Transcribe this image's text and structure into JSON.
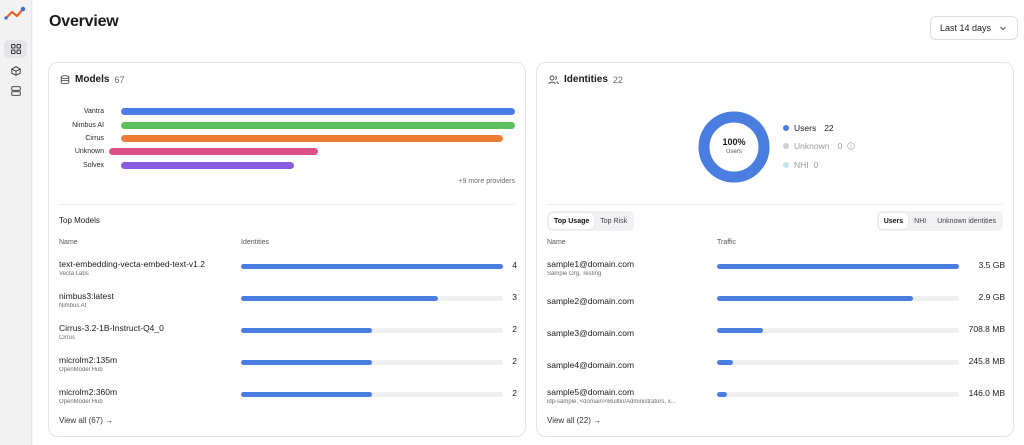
{
  "app": {
    "brand_colors": [
      "#e8622a",
      "#3a6fd8"
    ]
  },
  "sidebar": {
    "items": [
      {
        "icon": "grid-icon",
        "active": true
      },
      {
        "icon": "cube-icon",
        "active": false
      },
      {
        "icon": "server-icon",
        "active": false
      }
    ]
  },
  "header": {
    "title": "Overview",
    "range_label": "Last 14 days"
  },
  "models": {
    "title": "Models",
    "count": "67",
    "providers_chart": {
      "type": "bar",
      "categories": [
        "Vantra",
        "Nimbus AI",
        "Cirrus",
        "Unknown",
        "Solvex"
      ],
      "relative_values": [
        1.0,
        1.0,
        0.97,
        0.5,
        0.44
      ],
      "colors": [
        "#4a7de8",
        "#5cc05c",
        "#ec7c36",
        "#de4f8a",
        "#8a5be0"
      ]
    },
    "more_providers": "+9 more providers",
    "top_title": "Top Models",
    "col_name": "Name",
    "col_identities": "Identities",
    "rows": [
      {
        "name": "text-embedding-vecta-embed-text-v1.2",
        "sub": "Vecta Labs",
        "value": "4",
        "fraction": 1.0
      },
      {
        "name": "nimbus3:latest",
        "sub": "Nimbus AI",
        "value": "3",
        "fraction": 0.75
      },
      {
        "name": "Cirrus-3.2-1B-Instruct-Q4_0",
        "sub": "Cirrus",
        "value": "2",
        "fraction": 0.5
      },
      {
        "name": "microlm2:135m",
        "sub": "OpenModel Hub",
        "value": "2",
        "fraction": 0.5
      },
      {
        "name": "microlm2:360m",
        "sub": "OpenModel Hub",
        "value": "2",
        "fraction": 0.5
      }
    ],
    "view_all": "View all (67) →"
  },
  "identities": {
    "title": "Identities",
    "count": "22",
    "donut": {
      "percent": "100%",
      "caption": "Users",
      "fill_fraction": 1.0,
      "color": "#4a7de0"
    },
    "legend": [
      {
        "label": "Users",
        "value": "22",
        "color": "#4a7de0"
      },
      {
        "label": "Unknown",
        "value": "0",
        "color": "#cfcfd4"
      },
      {
        "label": "NHI",
        "value": "0",
        "color": "#bfe3ee"
      }
    ],
    "tabs_left": [
      {
        "label": "Top Usage",
        "active": true
      },
      {
        "label": "Top Risk",
        "active": false
      }
    ],
    "tabs_right": [
      {
        "label": "Users",
        "active": true
      },
      {
        "label": "NHI",
        "active": false
      },
      {
        "label": "Unknown identities",
        "active": false
      }
    ],
    "col_name": "Name",
    "col_traffic": "Traffic",
    "rows": [
      {
        "name": "sample1@domain.com",
        "sub": "Sample Org, Testing",
        "value": "3.5 GB",
        "fraction": 1.0
      },
      {
        "name": "sample2@domain.com",
        "sub": "",
        "value": "2.9 GB",
        "fraction": 0.81
      },
      {
        "name": "sample3@domain.com",
        "sub": "",
        "value": "708.8 MB",
        "fraction": 0.19
      },
      {
        "name": "sample4@domain.com",
        "sub": "",
        "value": "245.8 MB",
        "fraction": 0.065
      },
      {
        "name": "sample5@domain.com",
        "sub": "idp-sample, <domain>\\Builtin/Administrators, x...",
        "value": "146.0 MB",
        "fraction": 0.04
      }
    ],
    "view_all": "View all (22) →"
  }
}
